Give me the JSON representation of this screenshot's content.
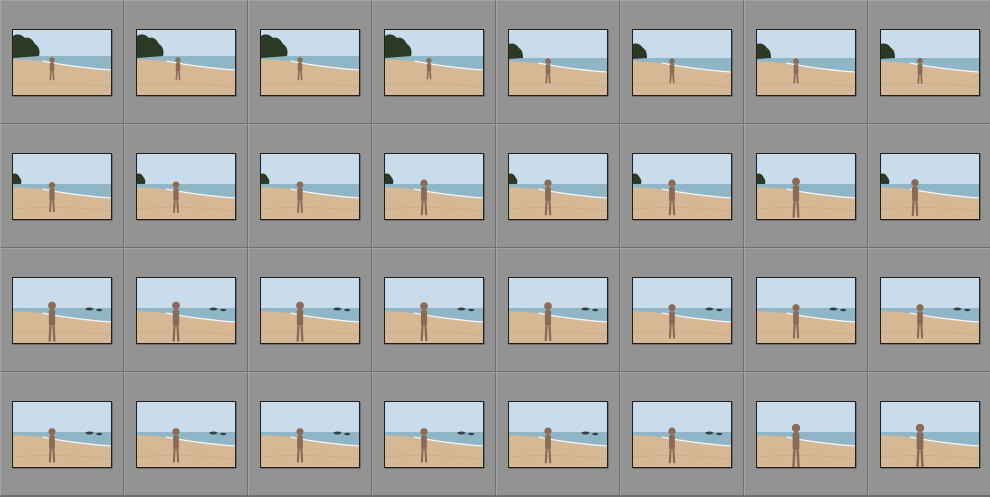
{
  "grid": {
    "columns": 8,
    "rows": 4,
    "thumbnails": [
      {
        "type": "A",
        "person": 0.4,
        "size": 0.25
      },
      {
        "type": "A",
        "person": 0.42,
        "size": 0.25
      },
      {
        "type": "A",
        "person": 0.4,
        "size": 0.25
      },
      {
        "type": "A",
        "person": 0.45,
        "size": 0.22
      },
      {
        "type": "B",
        "person": 0.4,
        "size": 0.3
      },
      {
        "type": "B",
        "person": 0.4,
        "size": 0.3
      },
      {
        "type": "B",
        "person": 0.4,
        "size": 0.3
      },
      {
        "type": "B",
        "person": 0.4,
        "size": 0.32
      },
      {
        "type": "C",
        "person": 0.4,
        "size": 0.42
      },
      {
        "type": "C",
        "person": 0.4,
        "size": 0.45
      },
      {
        "type": "C",
        "person": 0.4,
        "size": 0.45
      },
      {
        "type": "C",
        "person": 0.4,
        "size": 0.55
      },
      {
        "type": "C",
        "person": 0.4,
        "size": 0.55
      },
      {
        "type": "C",
        "person": 0.4,
        "size": 0.55
      },
      {
        "type": "C",
        "person": 0.4,
        "size": 0.65
      },
      {
        "type": "C",
        "person": 0.35,
        "size": 0.58
      },
      {
        "type": "D",
        "person": 0.4,
        "size": 0.65
      },
      {
        "type": "D",
        "person": 0.4,
        "size": 0.65
      },
      {
        "type": "D",
        "person": 0.4,
        "size": 0.65
      },
      {
        "type": "D",
        "person": 0.4,
        "size": 0.62
      },
      {
        "type": "D",
        "person": 0.4,
        "size": 0.62
      },
      {
        "type": "D",
        "person": 0.4,
        "size": 0.52
      },
      {
        "type": "D",
        "person": 0.4,
        "size": 0.52
      },
      {
        "type": "D",
        "person": 0.4,
        "size": 0.52
      },
      {
        "type": "E",
        "person": 0.4,
        "size": 0.52
      },
      {
        "type": "E",
        "person": 0.4,
        "size": 0.52
      },
      {
        "type": "E",
        "person": 0.4,
        "size": 0.52
      },
      {
        "type": "E",
        "person": 0.4,
        "size": 0.52
      },
      {
        "type": "E",
        "person": 0.4,
        "size": 0.55
      },
      {
        "type": "E",
        "person": 0.4,
        "size": 0.55
      },
      {
        "type": "F",
        "person": 0.4,
        "size": 0.75
      },
      {
        "type": "F",
        "person": 0.4,
        "size": 0.75
      }
    ]
  },
  "colors": {
    "panel": "#939393",
    "separator": "#6e6e6e",
    "thumb_border": "#1e1e1e",
    "sky": "#c9dceb",
    "sea": "#8fb6c6",
    "sand": "#d6b895",
    "trees": "#2a3a24",
    "figure": "#8b6b55"
  }
}
